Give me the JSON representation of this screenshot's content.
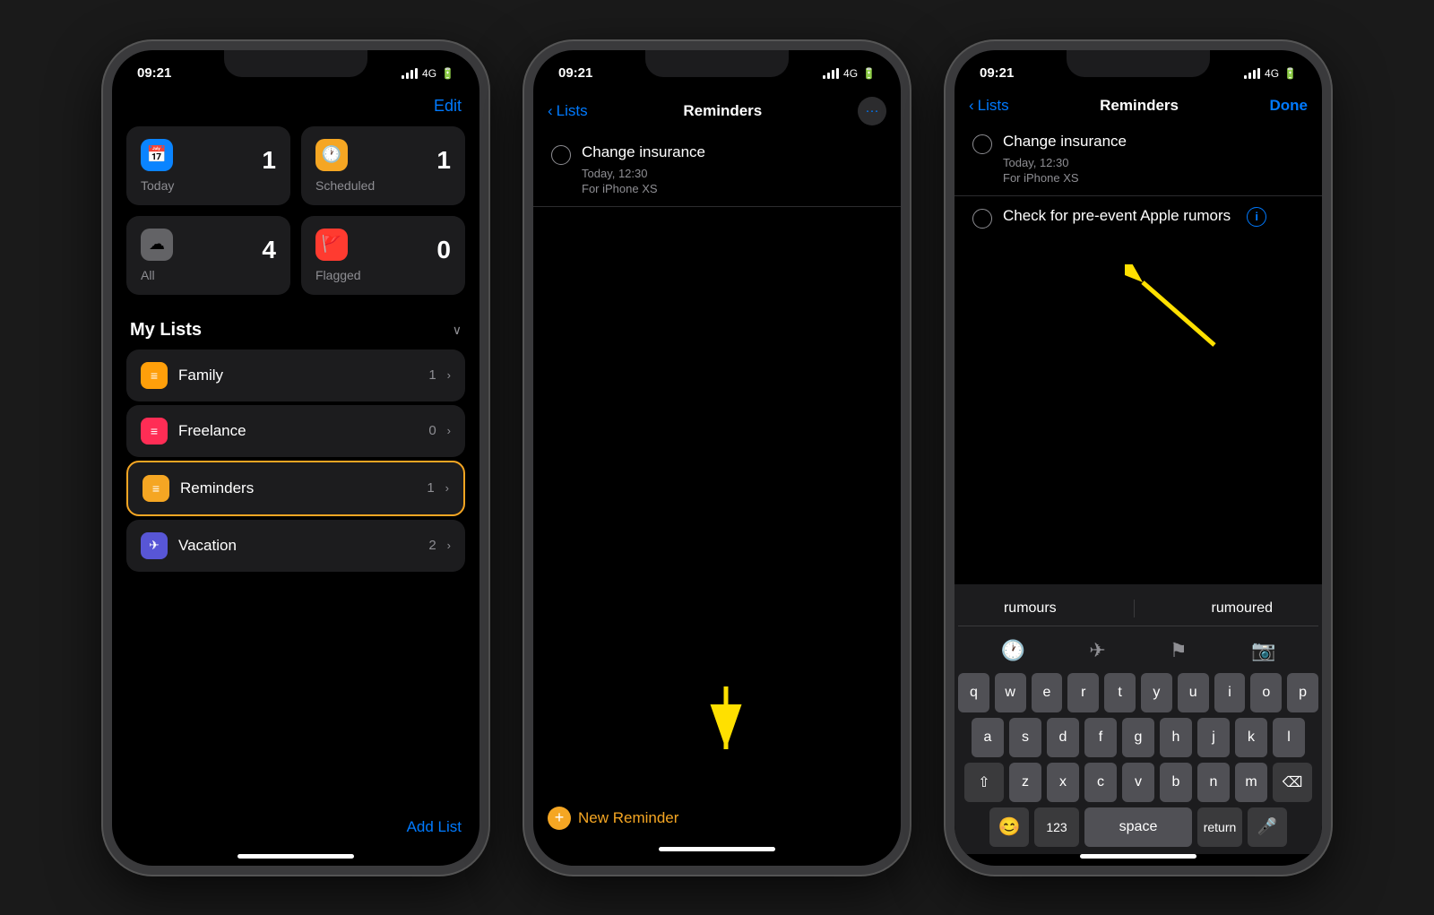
{
  "phones": [
    {
      "id": "phone1",
      "status": {
        "time": "09:21",
        "signal": "4G"
      },
      "header": {
        "edit_label": "Edit"
      },
      "grid": [
        {
          "id": "today",
          "icon": "📅",
          "icon_bg": "#0a84ff",
          "count": "1",
          "label": "Today"
        },
        {
          "id": "scheduled",
          "icon": "🕐",
          "icon_bg": "#f5a623",
          "count": "1",
          "label": "Scheduled"
        },
        {
          "id": "all",
          "icon": "☁",
          "icon_bg": "#636366",
          "count": "4",
          "label": "All"
        },
        {
          "id": "flagged",
          "icon": "🚩",
          "icon_bg": "#ff3b30",
          "count": "0",
          "label": "Flagged"
        }
      ],
      "my_lists": {
        "title": "My Lists",
        "items": [
          {
            "id": "family",
            "icon": "≡",
            "icon_bg": "#ff9f0a",
            "name": "Family",
            "count": "1",
            "highlighted": false
          },
          {
            "id": "freelance",
            "icon": "≡",
            "icon_bg": "#ff2d55",
            "name": "Freelance",
            "count": "0",
            "highlighted": false
          },
          {
            "id": "reminders",
            "icon": "≡",
            "icon_bg": "#f5a623",
            "name": "Reminders",
            "count": "1",
            "highlighted": true
          },
          {
            "id": "vacation",
            "icon": "✈",
            "icon_bg": "#5856d6",
            "name": "Vacation",
            "count": "2",
            "highlighted": false
          }
        ]
      },
      "add_list_label": "Add List"
    },
    {
      "id": "phone2",
      "status": {
        "time": "09:21",
        "signal": "4G"
      },
      "nav": {
        "back_label": "Lists",
        "title": "Reminders",
        "more": "···"
      },
      "reminders": [
        {
          "id": "change-insurance",
          "text": "Change insurance",
          "sub1": "Today, 12:30",
          "sub2": "For iPhone XS"
        }
      ],
      "new_reminder_label": "New Reminder"
    },
    {
      "id": "phone3",
      "status": {
        "time": "09:21",
        "signal": "4G"
      },
      "nav": {
        "back_label": "Lists",
        "title": "Reminders",
        "done_label": "Done"
      },
      "reminders": [
        {
          "id": "change-insurance",
          "text": "Change insurance",
          "sub1": "Today, 12:30",
          "sub2": "For iPhone XS"
        },
        {
          "id": "check-apple",
          "text": "Check for pre-event Apple rumors",
          "sub1": "",
          "sub2": ""
        }
      ],
      "autocomplete": {
        "word1": "rumours",
        "word2": "rumoured"
      },
      "keyboard": {
        "rows": [
          [
            "q",
            "w",
            "e",
            "r",
            "t",
            "y",
            "u",
            "i",
            "o",
            "p"
          ],
          [
            "a",
            "s",
            "d",
            "f",
            "g",
            "h",
            "j",
            "k",
            "l"
          ],
          [
            "z",
            "x",
            "c",
            "v",
            "b",
            "n",
            "m"
          ]
        ],
        "special": {
          "shift": "⇧",
          "delete": "⌫",
          "numbers": "123",
          "space": "space",
          "return": "return"
        }
      }
    }
  ]
}
